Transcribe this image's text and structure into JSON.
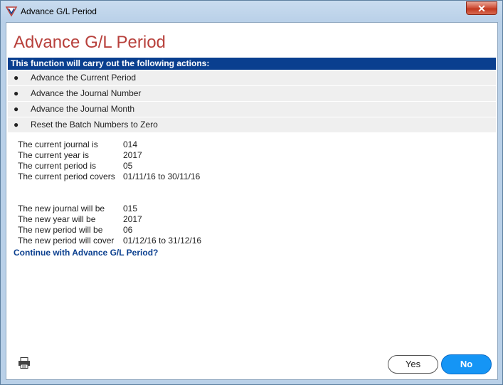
{
  "window": {
    "title": "Advance G/L Period",
    "close_label": "✕"
  },
  "dialog": {
    "heading": "Advance G/L Period",
    "banner": "This function will carry out the following actions:",
    "actions": [
      {
        "bullet": "●",
        "label": "Advance the Current Period"
      },
      {
        "bullet": "●",
        "label": "Advance the Journal Number"
      },
      {
        "bullet": "●",
        "label": "Advance the Journal Month"
      },
      {
        "bullet": "●",
        "label": "Reset the Batch Numbers to Zero"
      }
    ],
    "current": [
      {
        "label": "The current journal is",
        "value": "014"
      },
      {
        "label": "The current year is",
        "value": "2017"
      },
      {
        "label": "The current period is",
        "value": "05"
      },
      {
        "label": "The current period covers",
        "value": "01/11/16 to 30/11/16"
      }
    ],
    "new": [
      {
        "label": "The new journal will be",
        "value": "015"
      },
      {
        "label": "The new year will be",
        "value": "2017"
      },
      {
        "label": "The new period will be",
        "value": "06"
      },
      {
        "label": "The new period will cover",
        "value": "01/12/16 to 31/12/16"
      }
    ],
    "question": "Continue with Advance G/L Period?",
    "yes_label": "Yes",
    "no_label": "No"
  },
  "icons": {
    "app": "app-logo-icon",
    "print": "printer-icon"
  },
  "colors": {
    "heading": "#b8413c",
    "banner_bg": "#0a3f8f",
    "question": "#0a3f8f",
    "no_button": "#1595f5"
  }
}
